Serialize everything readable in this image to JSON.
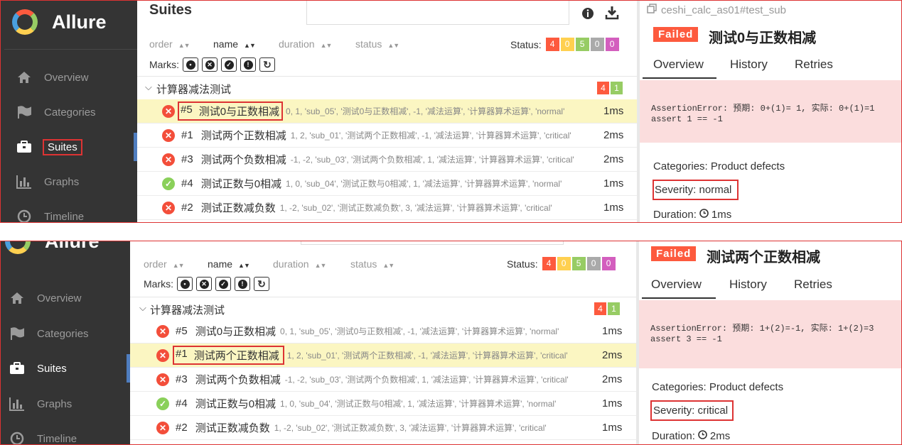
{
  "brand": {
    "name": "Allure"
  },
  "nav": [
    {
      "label": "Overview",
      "icon": "home-icon"
    },
    {
      "label": "Categories",
      "icon": "flag-icon"
    },
    {
      "label": "Suites",
      "icon": "briefcase-icon"
    },
    {
      "label": "Graphs",
      "icon": "bar-chart-icon"
    },
    {
      "label": "Timeline",
      "icon": "clock-icon"
    }
  ],
  "suites": {
    "title": "Suites",
    "sort": {
      "order": "order",
      "name": "name",
      "duration": "duration",
      "status": "status"
    },
    "status_label": "Status:",
    "status_counts": [
      {
        "value": "4",
        "color": "#fd5a3e"
      },
      {
        "value": "0",
        "color": "#ffd050"
      },
      {
        "value": "5",
        "color": "#97cc64"
      },
      {
        "value": "0",
        "color": "#aaaaaa"
      },
      {
        "value": "0",
        "color": "#d35ebe"
      }
    ],
    "marks_label": "Marks:",
    "group_name": "计算器减法测试",
    "group_counts": [
      {
        "value": "4",
        "color": "#fd5a3e"
      },
      {
        "value": "1",
        "color": "#97cc64"
      }
    ]
  },
  "panel1": {
    "rows": [
      {
        "status": "failed",
        "id": "#5",
        "name": "测试0与正数相减",
        "params": "0, 1, 'sub_05', '测试0与正数相减', -1, '减法运算', '计算器算术运算', 'normal'",
        "duration": "1ms"
      },
      {
        "status": "failed",
        "id": "#1",
        "name": "测试两个正数相减",
        "params": "1, 2, 'sub_01', '测试两个正数相减', -1, '减法运算', '计算器算术运算', 'critical'",
        "duration": "2ms"
      },
      {
        "status": "failed",
        "id": "#3",
        "name": "测试两个负数相减",
        "params": "-1, -2, 'sub_03', '测试两个负数相减', 1, '减法运算', '计算器算术运算', 'critical'",
        "duration": "2ms"
      },
      {
        "status": "passed",
        "id": "#4",
        "name": "测试正数与0相减",
        "params": "1, 0, 'sub_04', '测试正数与0相减', 1, '减法运算', '计算器算术运算', 'normal'",
        "duration": "1ms"
      },
      {
        "status": "failed",
        "id": "#2",
        "name": "测试正数减负数",
        "params": "1, -2, 'sub_02', '测试正数减负数', 3, '减法运算', '计算器算术运算', 'critical'",
        "duration": "1ms"
      }
    ],
    "detail": {
      "path": "ceshi_calc_as01#test_sub",
      "status_badge": "Failed",
      "title": "测试0与正数相减",
      "tabs": [
        "Overview",
        "History",
        "Retries"
      ],
      "error_line1": "AssertionError: 预期: 0+(1)= 1, 实际: 0+(1)=1",
      "error_line2": "assert 1 == -1",
      "categories": "Categories: Product defects",
      "severity": "Severity: normal",
      "duration_label": "Duration:",
      "duration": "1ms"
    }
  },
  "panel2": {
    "rows": [
      {
        "status": "failed",
        "id": "#5",
        "name": "测试0与正数相减",
        "params": "0, 1, 'sub_05', '测试0与正数相减', -1, '减法运算', '计算器算术运算', 'normal'",
        "duration": "1ms"
      },
      {
        "status": "failed",
        "id": "#1",
        "name": "测试两个正数相减",
        "params": "1, 2, 'sub_01', '测试两个正数相减', -1, '减法运算', '计算器算术运算', 'critical'",
        "duration": "2ms"
      },
      {
        "status": "failed",
        "id": "#3",
        "name": "测试两个负数相减",
        "params": "-1, -2, 'sub_03', '测试两个负数相减', 1, '减法运算', '计算器算术运算', 'critical'",
        "duration": "2ms"
      },
      {
        "status": "passed",
        "id": "#4",
        "name": "测试正数与0相减",
        "params": "1, 0, 'sub_04', '测试正数与0相减', 1, '减法运算', '计算器算术运算', 'normal'",
        "duration": "1ms"
      },
      {
        "status": "failed",
        "id": "#2",
        "name": "测试正数减负数",
        "params": "1, -2, 'sub_02', '测试正数减负数', 3, '减法运算', '计算器算术运算', 'critical'",
        "duration": "1ms"
      }
    ],
    "detail": {
      "status_badge": "Failed",
      "title": "测试两个正数相减",
      "tabs": [
        "Overview",
        "History",
        "Retries"
      ],
      "error_line1": "AssertionError: 预期: 1+(2)=-1, 实际: 1+(2)=3",
      "error_line2": "assert 3 == -1",
      "categories": "Categories: Product defects",
      "severity": "Severity: critical",
      "duration_label": "Duration:",
      "duration": "2ms"
    }
  }
}
